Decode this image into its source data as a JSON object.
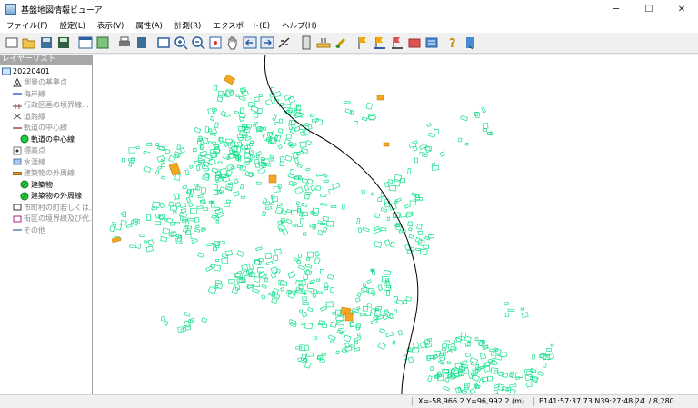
{
  "window": {
    "title": "基盤地図情報ビューア"
  },
  "menu": [
    "ファイル(F)",
    "設定(L)",
    "表示(V)",
    "属性(A)",
    "計測(R)",
    "エクスポート(E)",
    "ヘルプ(H)"
  ],
  "layers": {
    "header": "レイヤーリスト",
    "root": "20220401",
    "items": [
      {
        "label": "測量の基準点",
        "enabled": false
      },
      {
        "label": "海岸線",
        "enabled": false
      },
      {
        "label": "行政区画の境界線...",
        "enabled": false
      },
      {
        "label": "道路縁",
        "enabled": false
      },
      {
        "label": "軌道の中心線",
        "enabled": false
      },
      {
        "label": "軌道の中心線",
        "enabled": true
      },
      {
        "label": "標高点",
        "enabled": false
      },
      {
        "label": "水涯線",
        "enabled": false
      },
      {
        "label": "建築物の外周線",
        "enabled": false
      },
      {
        "label": "建築物",
        "enabled": true
      },
      {
        "label": "建築物の外周線",
        "enabled": true
      },
      {
        "label": "市町村の町若しくは...",
        "enabled": false
      },
      {
        "label": "街区の境界線及び代...",
        "enabled": false
      },
      {
        "label": "その他",
        "enabled": false
      }
    ]
  },
  "status": {
    "xy": "X=-58,966.2 Y=96,992.2 (m)",
    "latlon": "E141:57:37.73 N39:27:48.24",
    "scale": "1 / 8,280"
  },
  "colors": {
    "building_outline": "#14e08c",
    "building_fill": "#f5a623",
    "railway": "#000000"
  }
}
